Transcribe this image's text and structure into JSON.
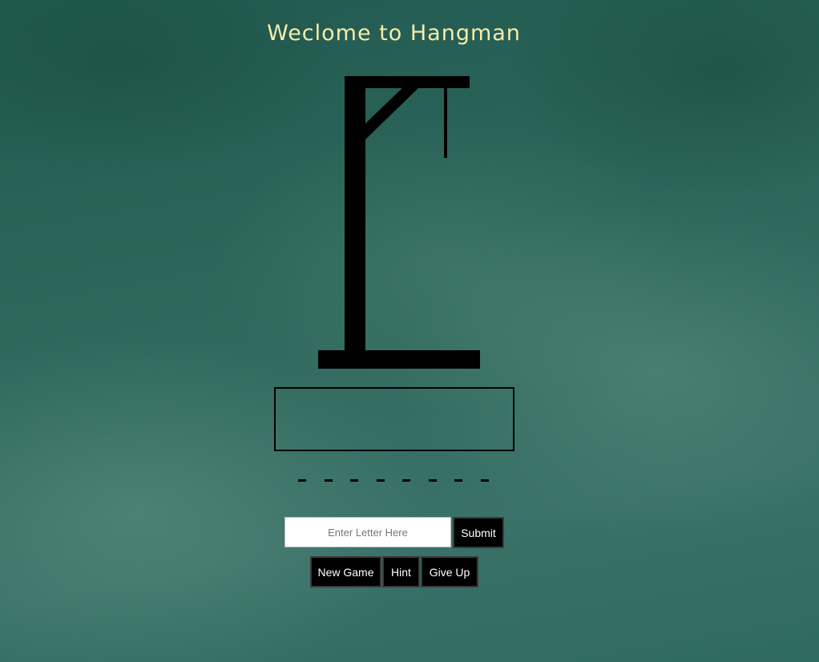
{
  "title": "Weclome to Hangman",
  "message": "",
  "word": {
    "blanks": [
      "_",
      "_",
      "_",
      "_",
      "_",
      "_",
      "_",
      "_"
    ]
  },
  "guess": {
    "placeholder": "Enter Letter Here",
    "value": "",
    "submit_label": "Submit"
  },
  "actions": {
    "new_game_label": "New Game",
    "hint_label": "Hint",
    "give_up_label": "Give Up"
  },
  "colors": {
    "title": "#f6ecaa",
    "board": "#2e665c",
    "gallows": "#000000",
    "button_bg": "#000000",
    "button_text": "#ffffff"
  }
}
